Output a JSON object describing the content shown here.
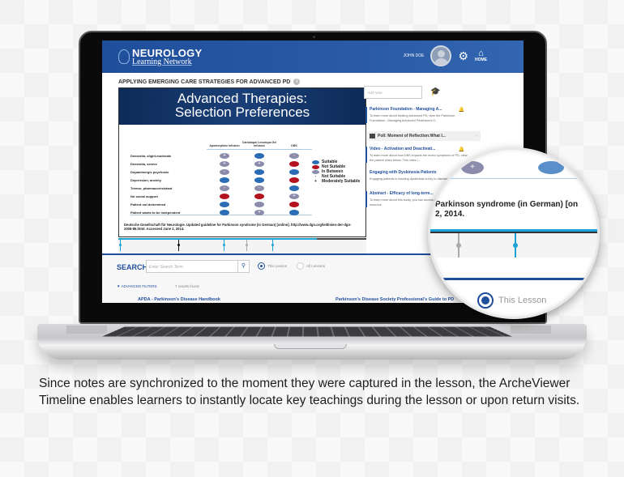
{
  "app": {
    "brand_top": "NEUROLOGY",
    "brand_bottom": "Learning Network",
    "user_name": "JOHN DOE",
    "home_label": "HOME",
    "primary_color": "#1f4e9b",
    "accent_color": "#1aa1d8"
  },
  "lesson": {
    "title": "APPLYING EMERGING CARE STRATEGIES FOR ADVANCED PD",
    "progress_percent": 80
  },
  "slide": {
    "title_line1": "Advanced Therapies:",
    "title_line2": "Selection Preferences",
    "columns": [
      "Apomorphine Infusion",
      "Carbidopa/ Levodopa Gel Infusion",
      "DBS"
    ],
    "rows": [
      {
        "label": "Dementia, slight-moderate",
        "cells": [
          "between+",
          "suitable",
          "between-"
        ]
      },
      {
        "label": "Dementia, severe",
        "cells": [
          "between+",
          "between+",
          "not"
        ]
      },
      {
        "label": "Dopaminergic psychosis",
        "cells": [
          "between-",
          "suitable",
          "suitable"
        ]
      },
      {
        "label": "Depression, anxiety",
        "cells": [
          "suitable",
          "suitable",
          "not"
        ]
      },
      {
        "label": "Tremor, pharmacoresistant",
        "cells": [
          "between-",
          "between-",
          "suitable"
        ]
      },
      {
        "label": "No social support",
        "cells": [
          "not",
          "not",
          "between+"
        ]
      },
      {
        "label": "Patient not determined",
        "cells": [
          "suitable",
          "between",
          "not"
        ]
      },
      {
        "label": "Patient wants to be independent",
        "cells": [
          "suitable",
          "between+",
          "suitable"
        ]
      }
    ],
    "legend": [
      {
        "type": "suitable",
        "label": "Suitable",
        "color": "#2a6db5"
      },
      {
        "type": "not",
        "label": "Not Suitable",
        "color": "#b3121e"
      },
      {
        "type": "between",
        "label": "In Between",
        "color": "#8b8bab"
      },
      {
        "type": "minus",
        "symbol": "-",
        "label": "Not Suitable"
      },
      {
        "type": "plus",
        "symbol": "+",
        "label": "Moderately Suitable"
      }
    ],
    "citation": "Deutsche Gesellschaft für Neurologie. Updated guideline for Parkinson syndrome (in German) [online]. http://www.dgn.org/leitlinien-der-dgn-2008-86.html. Accessed June 2, 2014."
  },
  "notes": {
    "placeholder": "Add Note",
    "resources": [
      {
        "title": "Parkinson Foundation - Managing A...",
        "desc": "To learn more about treating advanced PD, view the Parkinson Foundation - Managing Advanced Parkinson's D..."
      },
      {
        "title": "Video - Activation and Deactivati...",
        "desc": "To learn more about how DBS impacts the motor symptoms of PD, view the patient video below. This video i..."
      },
      {
        "title": "Engaging with Dyskinesia Patients",
        "desc": "Engaging patients in tracking dyskinesia is key to disease management."
      },
      {
        "title": "Abstract - Efficacy of long-term...",
        "desc": "To learn more about this study, you can access it by clicking on the related resource"
      }
    ],
    "poll": "Poll: Moment of Reflection:What I..."
  },
  "search": {
    "label": "SEARCH",
    "placeholder": "Enter Search Term",
    "option_this": "This Lesson",
    "option_all": "All Lessons",
    "advanced_filters": "ADVANCED FILTERS",
    "results_count": "7 results found",
    "results": [
      "APDA - Parkinson's Disease Handbook",
      "Parkinson's Disease Society Professional's Guide to PD"
    ]
  },
  "magnifier": {
    "line1": "Parkinson syndrome (in German) [on",
    "line2": "2, 2014.",
    "radio_label": "This Lesson"
  },
  "caption": "Since notes are synchronized to the moment they were captured in the lesson, the ArcheViewer Timeline enables learners to instantly locate key teachings during the lesson or upon return visits."
}
